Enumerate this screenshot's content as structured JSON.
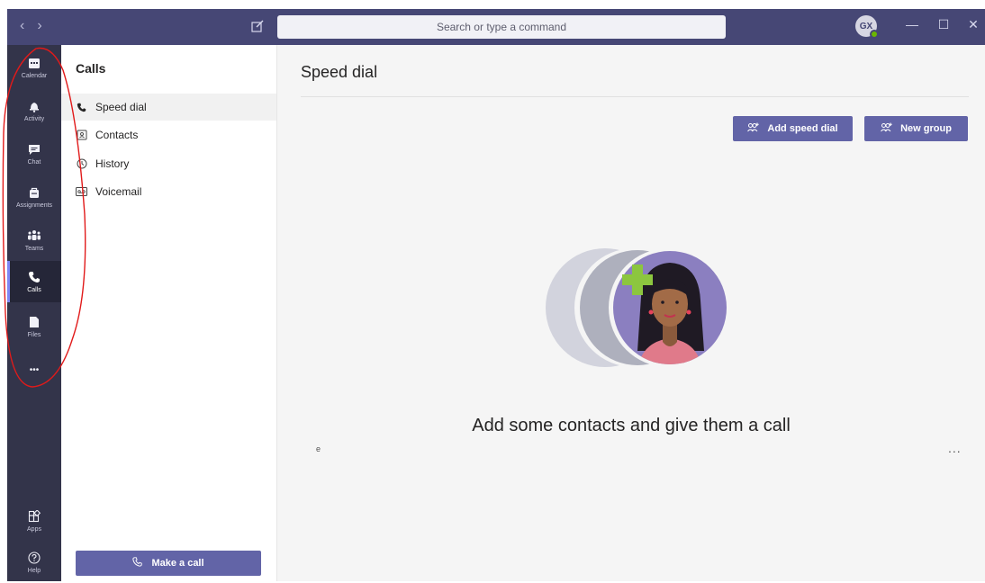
{
  "titlebar": {
    "search_placeholder": "Search or type a command",
    "avatar_initials": "GX",
    "nav_back": "‹",
    "nav_forward": "›",
    "minimize": "—",
    "maximize": "☐",
    "close": "✕"
  },
  "rail": {
    "items": [
      {
        "label": "Calendar",
        "icon": "calendar-icon"
      },
      {
        "label": "Activity",
        "icon": "bell-icon"
      },
      {
        "label": "Chat",
        "icon": "chat-icon"
      },
      {
        "label": "Assignments",
        "icon": "assignments-icon"
      },
      {
        "label": "Teams",
        "icon": "teams-icon"
      },
      {
        "label": "Calls",
        "icon": "phone-icon"
      },
      {
        "label": "Files",
        "icon": "file-icon"
      },
      {
        "label": "",
        "icon": "more-icon"
      },
      {
        "label": "Apps",
        "icon": "apps-icon"
      },
      {
        "label": "Help",
        "icon": "help-icon"
      }
    ],
    "more_glyph": "•••"
  },
  "leftpane": {
    "title": "Calls",
    "items": [
      {
        "label": "Speed dial",
        "icon": "phone-icon"
      },
      {
        "label": "Contacts",
        "icon": "contacts-icon"
      },
      {
        "label": "History",
        "icon": "history-icon"
      },
      {
        "label": "Voicemail",
        "icon": "voicemail-icon"
      }
    ],
    "make_call_label": "Make a call"
  },
  "main": {
    "title": "Speed dial",
    "add_speed_dial_label": "Add speed dial",
    "new_group_label": "New group",
    "empty_message": "Add some contacts and give them a call",
    "stray_char": "e",
    "more_label": "..."
  },
  "colors": {
    "titlebar": "#464775",
    "rail": "#33344a",
    "accent": "#6264a7",
    "annotation": "#e11a1a"
  }
}
